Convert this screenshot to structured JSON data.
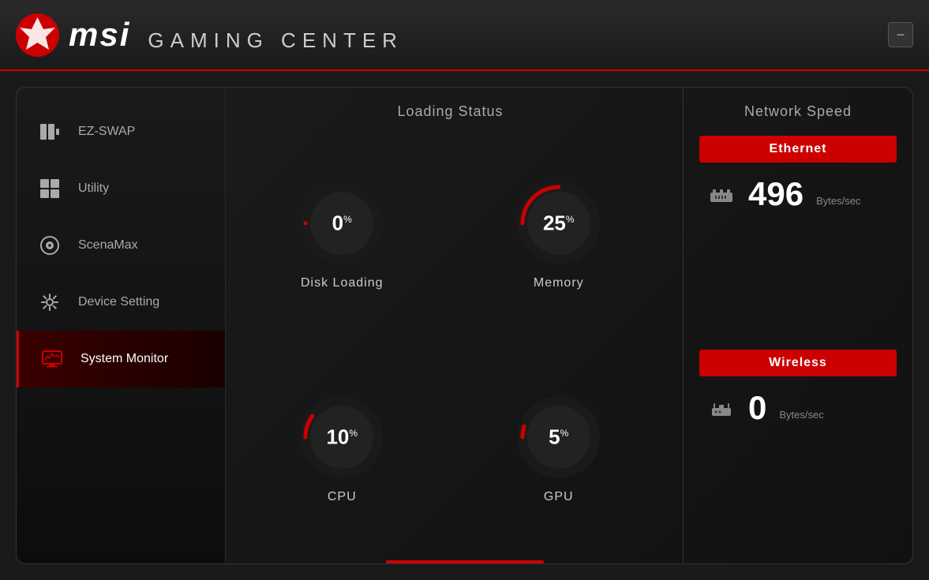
{
  "header": {
    "brand": "msi",
    "subtitle": "GAMING CENTER",
    "minimize_label": "−"
  },
  "sidebar": {
    "items": [
      {
        "id": "ez-swap",
        "label": "EZ-SWAP",
        "active": false
      },
      {
        "id": "utility",
        "label": "Utility",
        "active": false
      },
      {
        "id": "scenamax",
        "label": "ScenaMax",
        "active": false
      },
      {
        "id": "device-setting",
        "label": "Device Setting",
        "active": false
      },
      {
        "id": "system-monitor",
        "label": "System Monitor",
        "active": true
      }
    ]
  },
  "main": {
    "loading_status": {
      "title": "Loading Status",
      "gauges": [
        {
          "id": "disk",
          "label": "Disk Loading",
          "value": "0",
          "unit": "%",
          "percent": 0,
          "color": "#cc0000"
        },
        {
          "id": "memory",
          "label": "Memory",
          "value": "25",
          "unit": "%",
          "percent": 25,
          "color": "#cc0000"
        },
        {
          "id": "cpu",
          "label": "CPU",
          "value": "10",
          "unit": "%",
          "percent": 10,
          "color": "#cc0000"
        },
        {
          "id": "gpu",
          "label": "GPU",
          "value": "5",
          "unit": "%",
          "percent": 5,
          "color": "#cc0000"
        }
      ]
    },
    "network_speed": {
      "title": "Network Speed",
      "ethernet": {
        "label": "Ethernet",
        "value": "496",
        "unit": "Bytes/sec"
      },
      "wireless": {
        "label": "Wireless",
        "value": "0",
        "unit": "Bytes/sec"
      }
    }
  }
}
